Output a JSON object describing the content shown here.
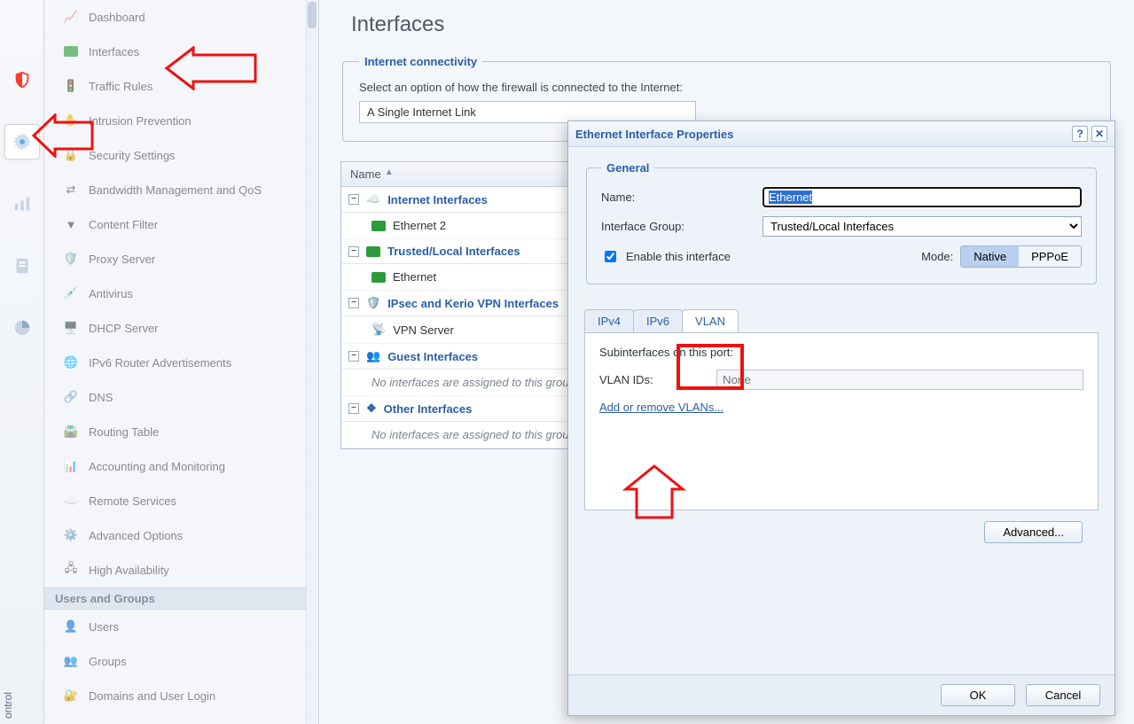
{
  "page": {
    "title": "Interfaces"
  },
  "rail": {
    "items": [
      "shield",
      "gear",
      "bars",
      "doc",
      "pie"
    ],
    "active_index": 1,
    "bottom_label": "ontrol"
  },
  "sidebar": {
    "items": [
      {
        "label": "Dashboard",
        "icon": "dashboard"
      },
      {
        "label": "Interfaces",
        "icon": "interfaces"
      },
      {
        "label": "Traffic Rules",
        "icon": "traffic"
      },
      {
        "label": "Intrusion Prevention",
        "icon": "intrusion"
      },
      {
        "label": "Security Settings",
        "icon": "security"
      },
      {
        "label": "Bandwidth Management and QoS",
        "icon": "bandwidth"
      },
      {
        "label": "Content Filter",
        "icon": "filter"
      },
      {
        "label": "Proxy Server",
        "icon": "proxy"
      },
      {
        "label": "Antivirus",
        "icon": "antivirus"
      },
      {
        "label": "DHCP Server",
        "icon": "dhcp"
      },
      {
        "label": "IPv6 Router Advertisements",
        "icon": "ipv6"
      },
      {
        "label": "DNS",
        "icon": "dns"
      },
      {
        "label": "Routing Table",
        "icon": "routing"
      },
      {
        "label": "Accounting and Monitoring",
        "icon": "accounting"
      },
      {
        "label": "Remote Services",
        "icon": "remote"
      },
      {
        "label": "Advanced Options",
        "icon": "advanced"
      },
      {
        "label": "High Availability",
        "icon": "ha"
      }
    ],
    "group_header": "Users and Groups",
    "group_items": [
      {
        "label": "Users",
        "icon": "users"
      },
      {
        "label": "Groups",
        "icon": "groups"
      },
      {
        "label": "Domains and User Login",
        "icon": "domains"
      }
    ]
  },
  "connectivity": {
    "legend": "Internet connectivity",
    "desc": "Select an option of how the firewall is connected to the Internet:",
    "selected": "A Single Internet Link"
  },
  "grid": {
    "name_header": "Name",
    "groups": [
      {
        "label": "Internet Interfaces",
        "icon": "cloud",
        "rows": [
          {
            "label": "Ethernet 2",
            "icon": "nic"
          }
        ]
      },
      {
        "label": "Trusted/Local Interfaces",
        "icon": "nic-trusted",
        "rows": [
          {
            "label": "Ethernet",
            "icon": "nic"
          }
        ]
      },
      {
        "label": "IPsec and Kerio VPN Interfaces",
        "icon": "vpn-shield",
        "rows": [
          {
            "label": "VPN Server",
            "icon": "vpn"
          }
        ]
      },
      {
        "label": "Guest Interfaces",
        "icon": "guest",
        "rows": [],
        "empty": "No interfaces are assigned to this group."
      },
      {
        "label": "Other Interfaces",
        "icon": "other",
        "rows": [],
        "empty": "No interfaces are assigned to this group."
      }
    ]
  },
  "dialog": {
    "title": "Ethernet Interface Properties",
    "general_legend": "General",
    "name_label": "Name:",
    "name_value": "Ethernet",
    "ifgroup_label": "Interface Group:",
    "ifgroup_value": "Trusted/Local Interfaces",
    "enable_label": "Enable this interface",
    "enable_checked": true,
    "mode_label": "Mode:",
    "mode_native": "Native",
    "mode_pppoe": "PPPoE",
    "tabs": {
      "ipv4": "IPv4",
      "ipv6": "IPv6",
      "vlan": "VLAN",
      "active": "vlan"
    },
    "vlan": {
      "sub_label": "Subinterfaces on this port:",
      "ids_label": "VLAN IDs:",
      "ids_placeholder": "None",
      "link": "Add or remove VLANs..."
    },
    "advanced": "Advanced...",
    "ok": "OK",
    "cancel": "Cancel",
    "help": "?",
    "close": "✕"
  }
}
